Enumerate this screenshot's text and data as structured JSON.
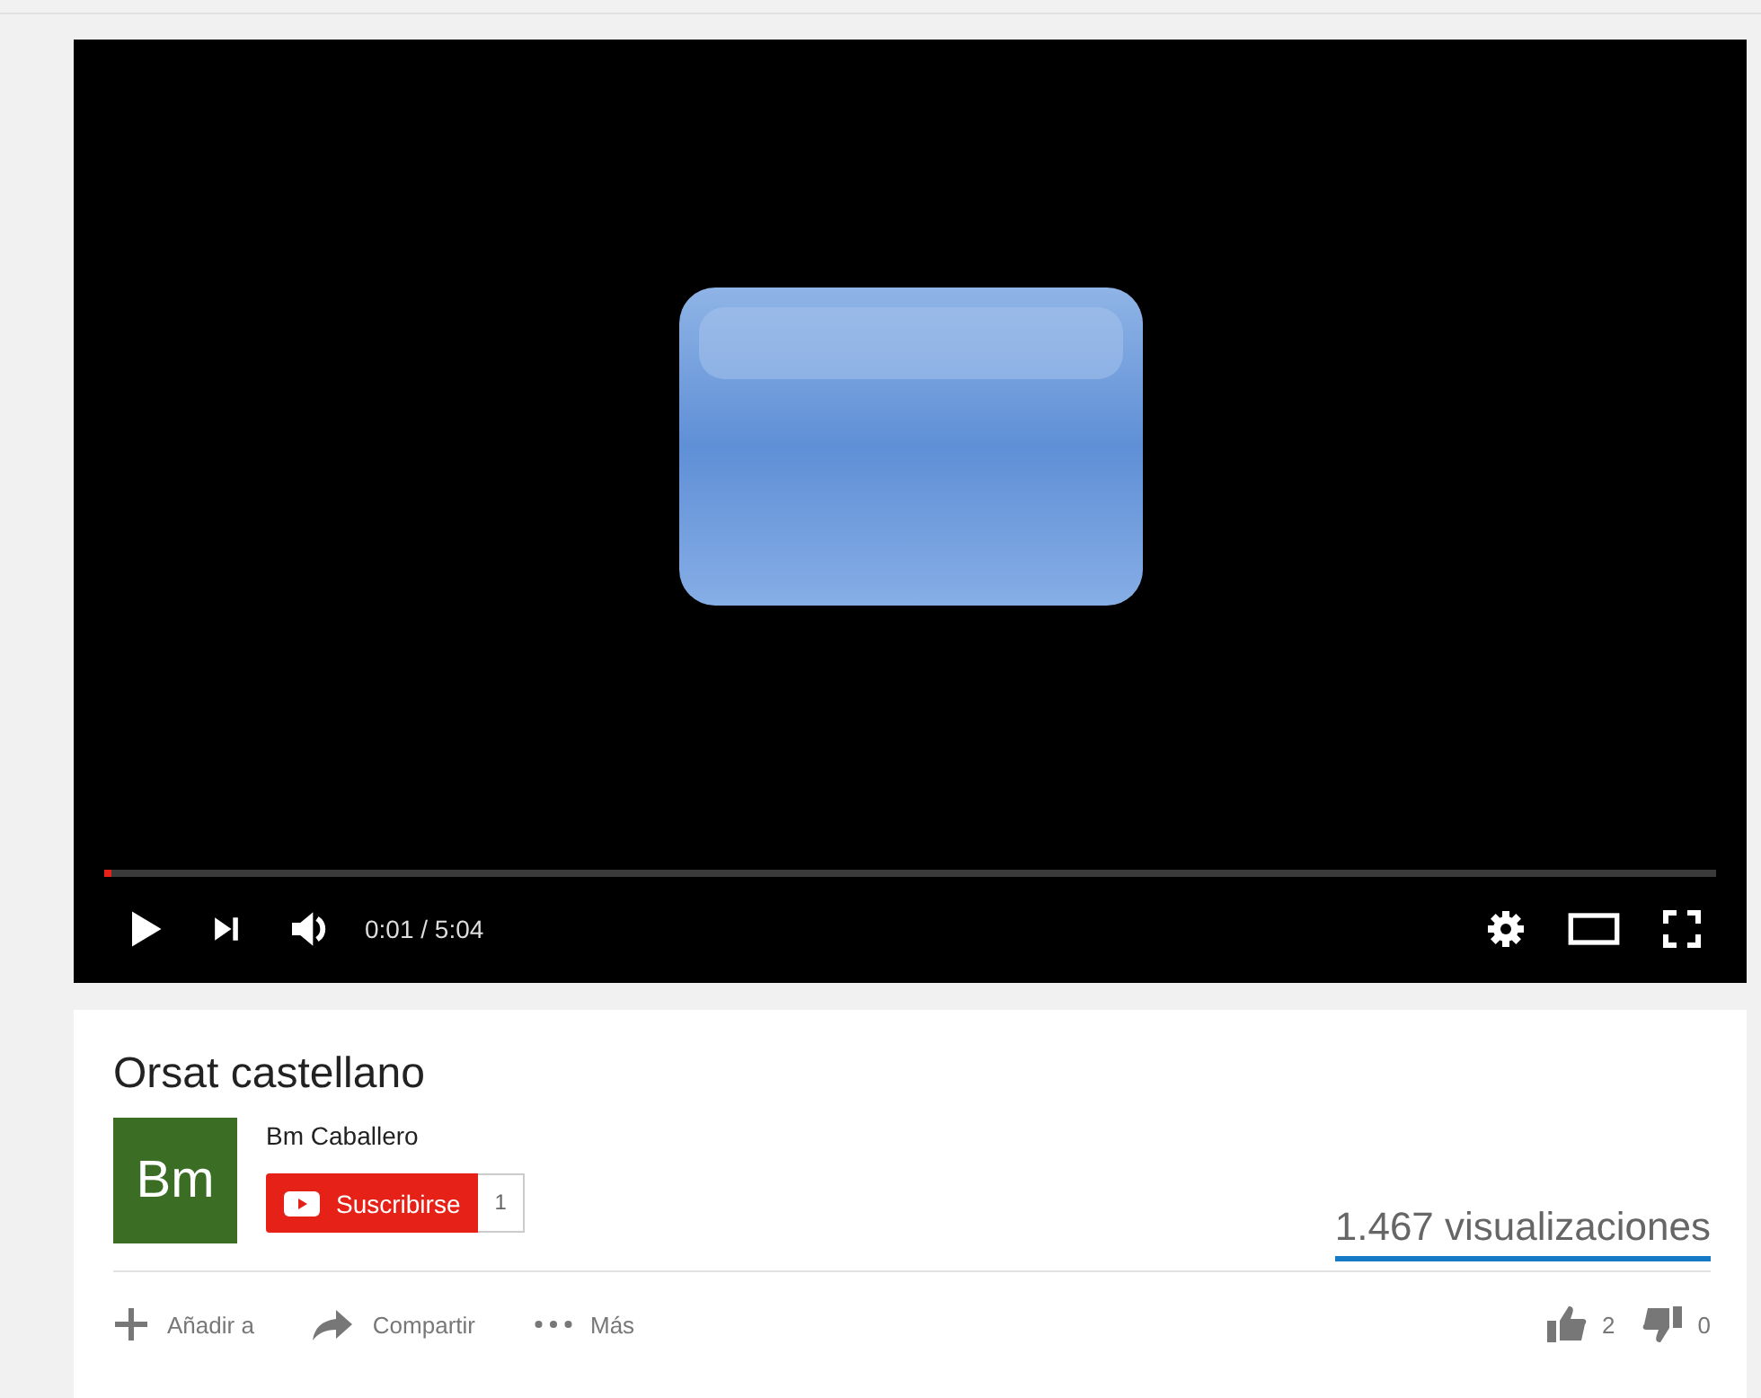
{
  "video": {
    "progress": {
      "level": 0.004
    },
    "time": "0:01 / 5:04"
  },
  "title": "Orsat castellano",
  "channel": {
    "avatar": "Bm",
    "name": "Bm Caballero",
    "subscribe": "Suscribirse",
    "subscribers": "1"
  },
  "views": "1.467 visualizaciones",
  "actions": [
    {
      "kind": "add",
      "label": "Añadir a"
    },
    {
      "kind": "share",
      "label": "Compartir"
    },
    {
      "kind": "more",
      "label": "Más"
    }
  ],
  "likes": "2",
  "dislikes": "0"
}
